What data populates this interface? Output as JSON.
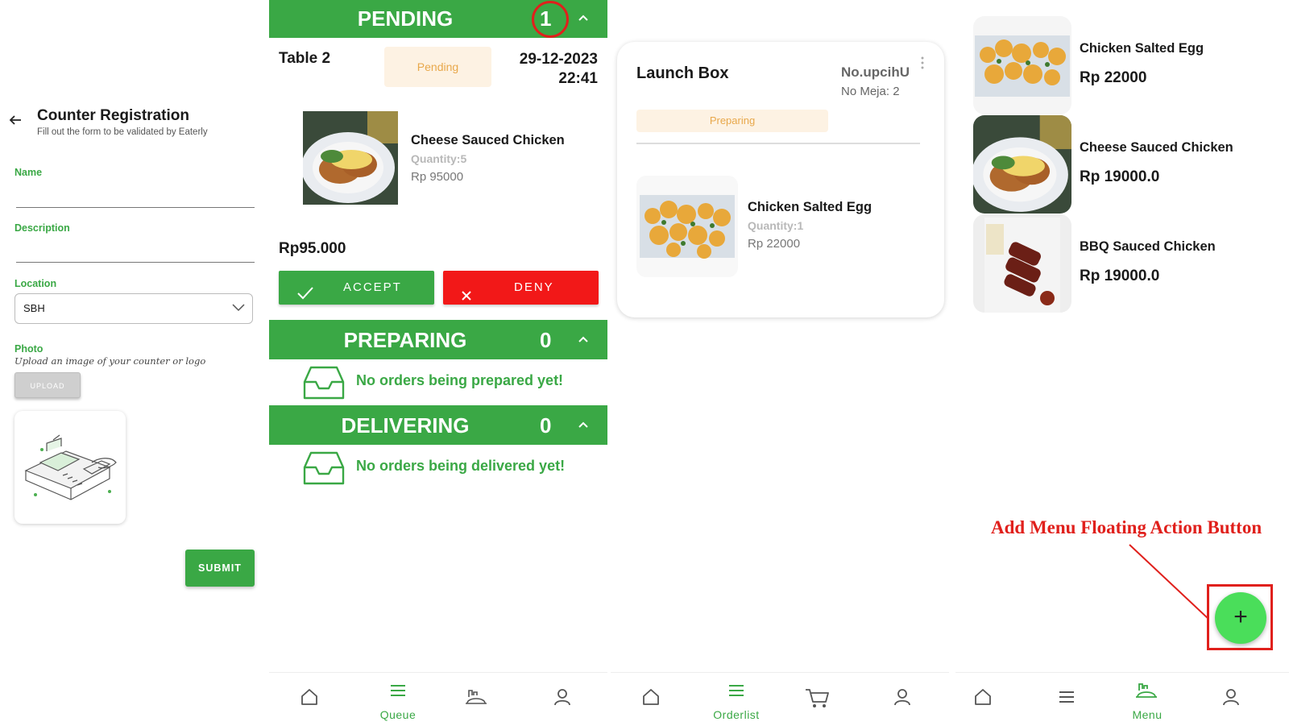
{
  "registration": {
    "title": "Counter Registration",
    "subtitle": "Fill out the form to be validated by Eaterly",
    "name_label": "Name",
    "description_label": "Description",
    "location_label": "Location",
    "location_value": "SBH",
    "photo_label": "Photo",
    "photo_hint": "Upload an image of your counter or logo",
    "upload_label": "UPLOAD",
    "submit_label": "SUBMIT"
  },
  "queue": {
    "pending": {
      "title": "PENDING",
      "count": "1"
    },
    "order": {
      "table": "Table 2",
      "status": "Pending",
      "date": "29-12-2023",
      "time": "22:41",
      "item_name": "Cheese Sauced Chicken",
      "item_quantity": "Quantity:5",
      "item_price": "Rp 95000",
      "total": "Rp95.000",
      "accept_label": "ACCEPT",
      "deny_label": "DENY"
    },
    "preparing": {
      "title": "PREPARING",
      "count": "0",
      "empty": "No orders being prepared yet!"
    },
    "delivering": {
      "title": "DELIVERING",
      "count": "0",
      "empty": "No orders being delivered yet!"
    },
    "nav": {
      "active_label": "Queue"
    }
  },
  "orderlist": {
    "counter_name": "Launch Box",
    "order_no": "No.upcihU",
    "table_no": "No Meja:  2",
    "status": "Preparing",
    "item_name": "Chicken Salted Egg",
    "item_quantity": "Quantity:1",
    "item_price": "Rp 22000",
    "nav": {
      "active_label": "Orderlist"
    }
  },
  "menu": {
    "items": [
      {
        "name": "Chicken Salted Egg",
        "price": "Rp 22000"
      },
      {
        "name": "Cheese Sauced Chicken",
        "price": "Rp 19000.0"
      },
      {
        "name": "BBQ Sauced Chicken",
        "price": "Rp 19000.0"
      }
    ],
    "annotation": "Add Menu Floating Action Button",
    "fab_label": "+",
    "nav": {
      "active_label": "Menu"
    }
  },
  "colors": {
    "primary_green": "#3aa845",
    "deny_red": "#f21818",
    "badge_bg": "#fdf2e3",
    "badge_text": "#e8a84b",
    "fab_green": "#4ade5a",
    "annotation_red": "#e0201c"
  },
  "icons": [
    "back-arrow-icon",
    "chevron-down-icon",
    "chevron-up-icon",
    "check-icon",
    "close-icon",
    "inbox-icon",
    "more-vert-icon",
    "home-icon",
    "list-icon",
    "food-tray-icon",
    "cart-icon",
    "user-icon",
    "plus-icon"
  ]
}
